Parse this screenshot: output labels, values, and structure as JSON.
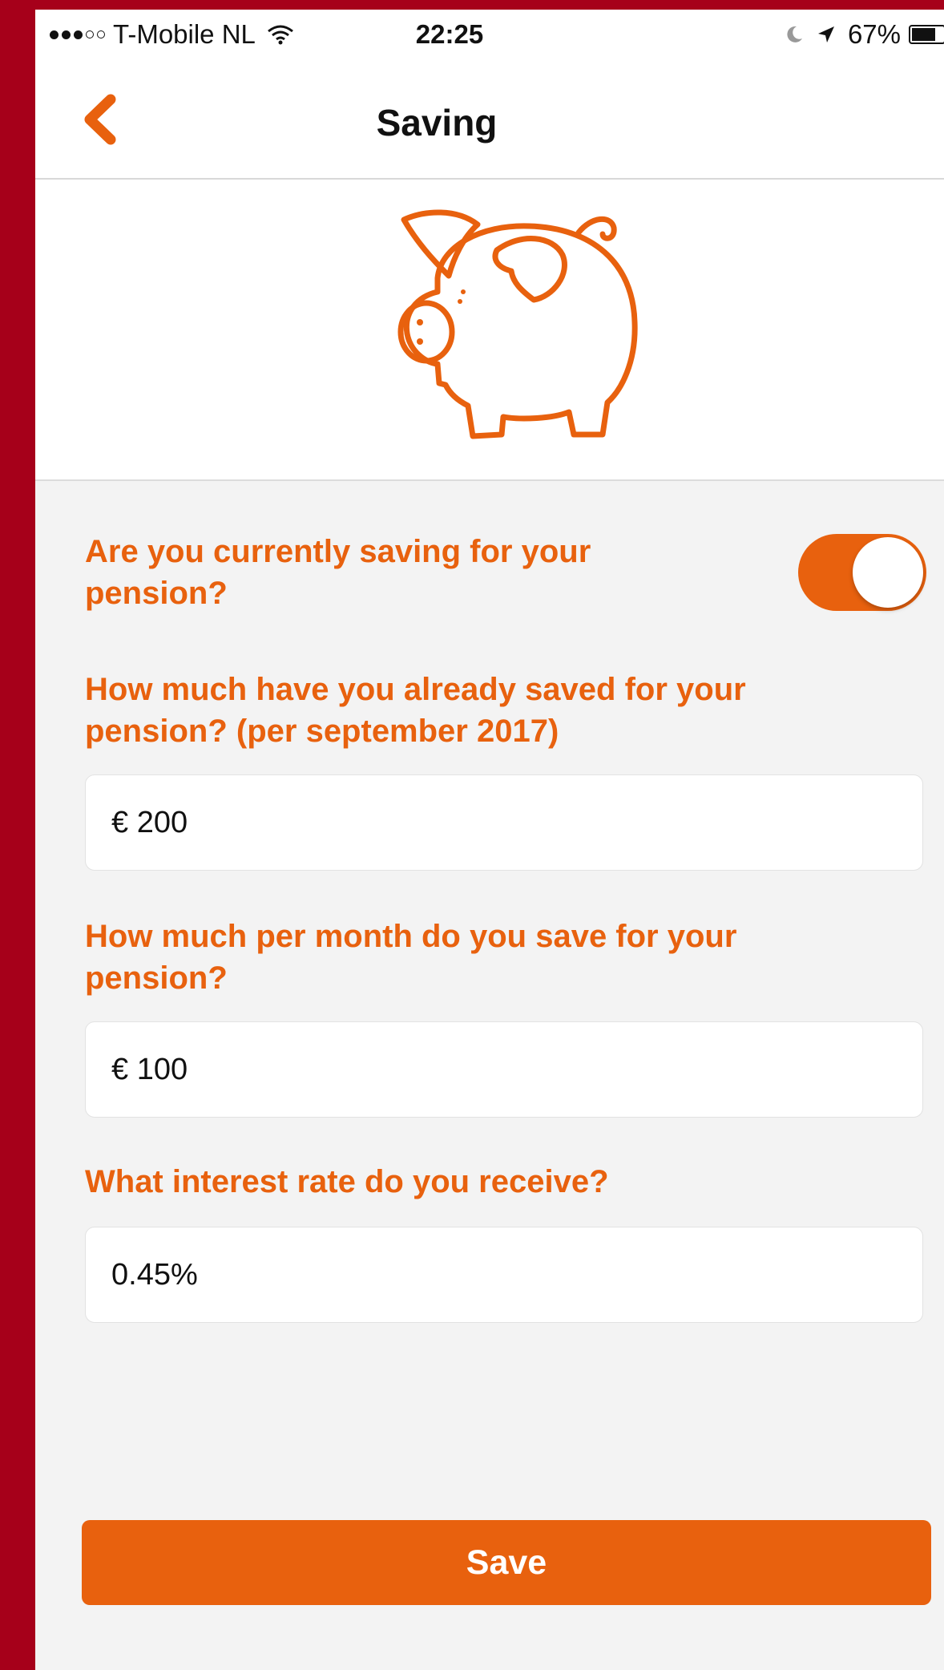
{
  "status_bar": {
    "carrier": "T-Mobile NL",
    "time": "22:25",
    "battery": "67%"
  },
  "nav": {
    "title": "Saving"
  },
  "form": {
    "currently_saving": {
      "label": "Are you currently saving for your pension?",
      "value": true
    },
    "already_saved": {
      "label": "How much have you already saved for your pension? (per september 2017)",
      "value": "€ 200"
    },
    "monthly_saving": {
      "label": "How much per month do you save for your pension?",
      "value": "€ 100"
    },
    "interest_rate": {
      "label": "What interest rate do you receive?",
      "value": "0.45%"
    }
  },
  "actions": {
    "save_label": "Save"
  },
  "colors": {
    "accent": "#e8610e",
    "frame": "#a6001a",
    "background": "#f3f3f3"
  }
}
